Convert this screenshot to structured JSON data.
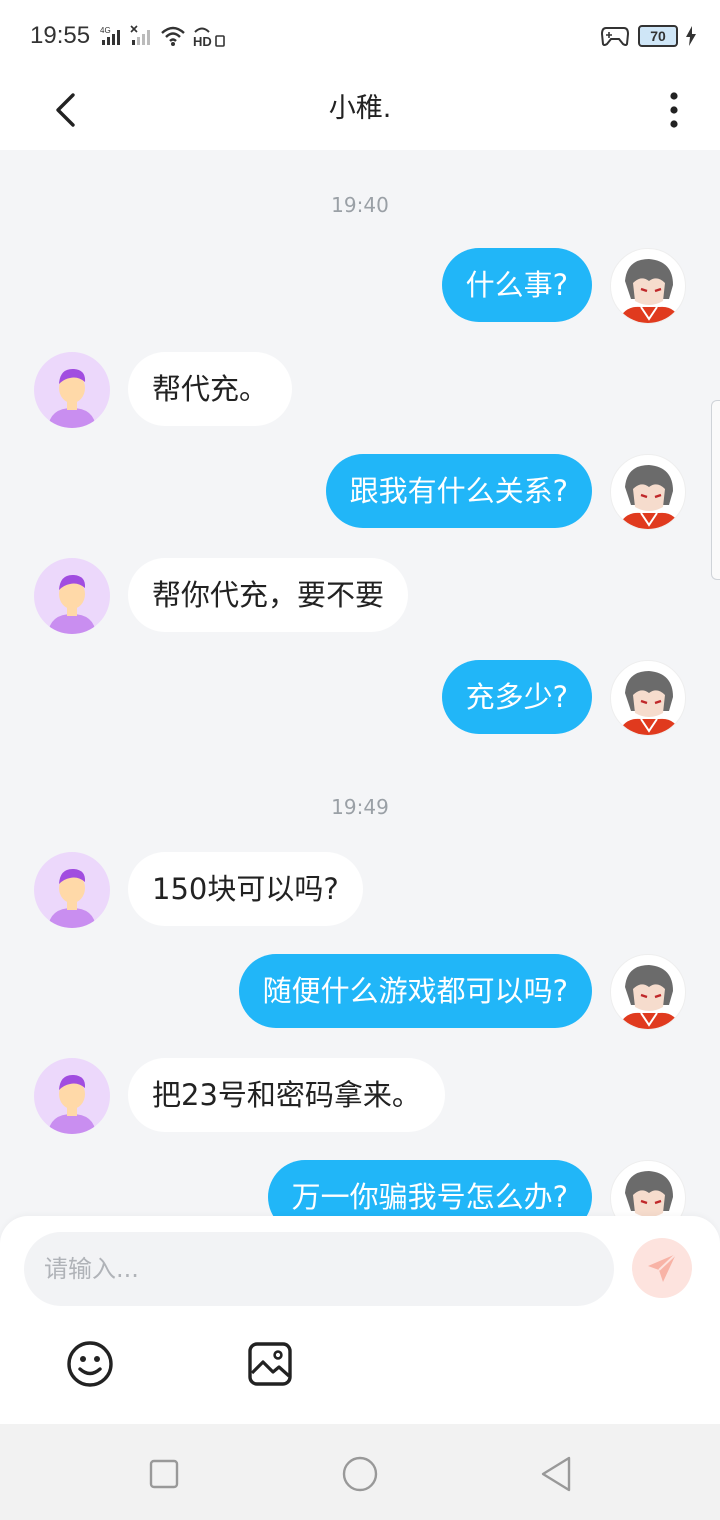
{
  "status_bar": {
    "time": "19:55",
    "network_left": "4G",
    "hd_label": "HD",
    "battery": "70"
  },
  "header": {
    "title": "小稚."
  },
  "chat": {
    "timestamps": [
      "19:40",
      "19:49"
    ],
    "messages": [
      {
        "side": "right",
        "text": "什么事?"
      },
      {
        "side": "left",
        "text": "帮代充。"
      },
      {
        "side": "right",
        "text": "跟我有什么关系?"
      },
      {
        "side": "left",
        "text": "帮你代充，要不要"
      },
      {
        "side": "right",
        "text": "充多少?"
      },
      {
        "side": "left",
        "text": "150块可以吗?"
      },
      {
        "side": "right",
        "text": "随便什么游戏都可以吗?"
      },
      {
        "side": "left",
        "text": "把23号和密码拿来。"
      },
      {
        "side": "right",
        "text": "万一你骗我号怎么办?"
      }
    ]
  },
  "composer": {
    "placeholder": "请输入..."
  },
  "colors": {
    "accent": "#21b6f8",
    "send_button": "#fde3de",
    "background": "#f4f5f7"
  },
  "icons": {
    "back": "chevron-left-icon",
    "more": "more-vertical-icon",
    "send": "paper-plane-icon",
    "emoji": "smiley-icon",
    "image": "image-icon",
    "nav_recent": "square-icon",
    "nav_home": "circle-icon",
    "nav_back": "triangle-left-icon"
  }
}
